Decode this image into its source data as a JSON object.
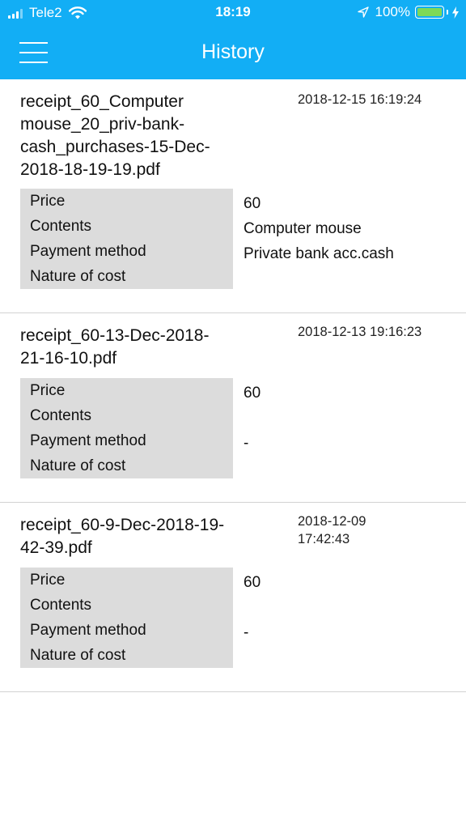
{
  "status_bar": {
    "carrier": "Tele2",
    "time": "18:19",
    "battery": "100%",
    "battery_level": 1.0
  },
  "header": {
    "title": "History",
    "menu_icon": "hamburger-menu-icon"
  },
  "labels": {
    "price": "Price",
    "contents": "Contents",
    "payment_method": "Payment method",
    "nature_of_cost": "Nature of cost"
  },
  "receipts": [
    {
      "filename": "receipt_60_Computer mouse_20_priv-bank-cash_purchases-15-Dec-2018-18-19-19.pdf",
      "date": "2018-12-15 16:19:24",
      "price": "60",
      "contents": "Computer mouse",
      "payment_method": "Private bank acc.cash",
      "nature_of_cost": ""
    },
    {
      "filename": "receipt_60-13-Dec-2018-21-16-10.pdf",
      "date": "2018-12-13 19:16:23",
      "price": "60",
      "contents": "",
      "payment_method": "-",
      "nature_of_cost": ""
    },
    {
      "filename": "receipt_60-9-Dec-2018-19-42-39.pdf",
      "date": "2018-12-09 17:42:43",
      "price": "60",
      "contents": "",
      "payment_method": "-",
      "nature_of_cost": ""
    }
  ]
}
